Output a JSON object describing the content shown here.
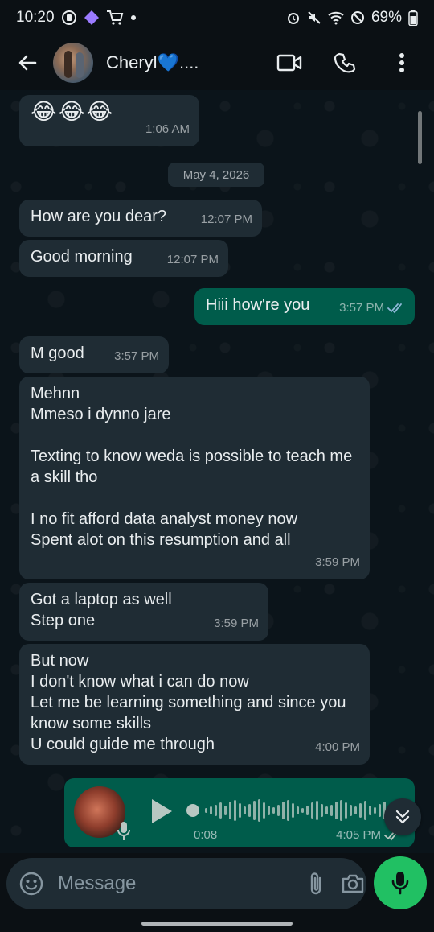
{
  "status_bar": {
    "time": "10:20",
    "battery": "69%"
  },
  "header": {
    "contact_name": "Cheryl💙....",
    "icons": [
      "back-arrow-icon",
      "video-call-icon",
      "phone-icon",
      "more-vert-icon"
    ]
  },
  "messages": [
    {
      "dir": "in",
      "text": "😂😂😂",
      "time": "1:06 AM"
    },
    {
      "dir": "in",
      "text": "How are you dear?",
      "time": "12:07 PM"
    },
    {
      "dir": "in",
      "text": "Good morning",
      "time": "12:07 PM"
    },
    {
      "dir": "out",
      "text": "Hiii how're you",
      "time": "3:57 PM",
      "status": "read"
    },
    {
      "dir": "in",
      "text": "M good",
      "time": "3:57 PM"
    },
    {
      "dir": "in",
      "text": "Mehnn\nMmeso i dynno jare\n\nTexting to know weda is possible to teach me a skill tho\n\nI no fit afford data analyst money now\nSpent alot on this resumption and all",
      "time": "3:59 PM"
    },
    {
      "dir": "in",
      "text": "Got a laptop as well\nStep one",
      "time": "3:59 PM"
    },
    {
      "dir": "in",
      "text": "But now\nI don't know what i can do now\nLet me be learning something and since you know some skills\nU could guide me through",
      "time": "4:00 PM"
    }
  ],
  "date_chip": "May 4, 2026",
  "voice_note": {
    "duration": "0:08",
    "time": "4:05 PM",
    "progress": 0.0
  },
  "composer": {
    "placeholder": "Message"
  },
  "colors": {
    "incoming_bubble": "#1f2c34",
    "outgoing_bubble": "#005c4b",
    "send_button": "#21c063",
    "chat_bg": "#0b141a"
  }
}
